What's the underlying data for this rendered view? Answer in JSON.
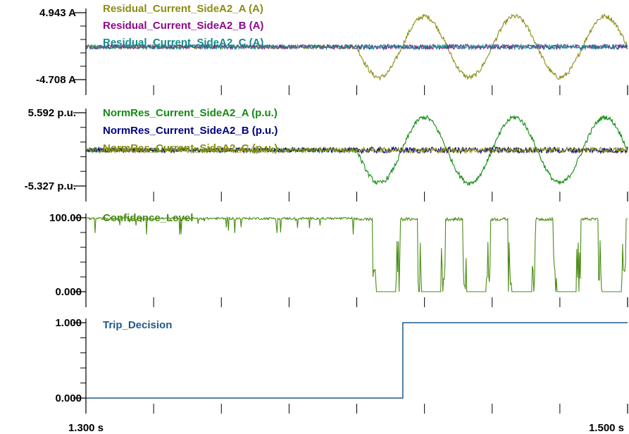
{
  "chart_data": [
    {
      "type": "line",
      "ytick_labels": [
        "4.943 A",
        "-4.708 A"
      ],
      "ylim": [
        -4.708,
        4.943
      ],
      "x": [
        1.3,
        1.5
      ],
      "series": [
        {
          "name": "Residual_Current_SideA2_A (A)",
          "color": "#8c8c14",
          "description_values": {
            "pre_fault_amplitude": 0.3,
            "fault_start": 1.4,
            "fault_amplitude": 4.4,
            "frequency_hz": 30
          }
        },
        {
          "name": "Residual_Current_SideA2_B (A)",
          "color": "#8b0a8b",
          "description_values": {
            "pre_fault_amplitude": 0.3,
            "fault_amplitude": 0.35
          }
        },
        {
          "name": "Residual_Current_SideA2_C (A)",
          "color": "#148c8c",
          "description_values": {
            "pre_fault_amplitude": 0.3,
            "fault_amplitude": 0.35
          }
        }
      ]
    },
    {
      "type": "line",
      "ytick_labels": [
        "5.592 p.u.",
        "-5.327 p.u."
      ],
      "ylim": [
        -5.327,
        5.592
      ],
      "x": [
        1.3,
        1.5
      ],
      "series": [
        {
          "name": "NormRes_Current_SideA2_A (p.u.)",
          "color": "#148c14",
          "description_values": {
            "pre_fault_amplitude": 0.35,
            "fault_start": 1.4,
            "fault_amplitude": 4.9,
            "frequency_hz": 30
          }
        },
        {
          "name": "NormRes_Current_SideA2_B (p.u.)",
          "color": "#000080",
          "description_values": {
            "pre_fault_amplitude": 0.35,
            "fault_amplitude": 0.45
          }
        },
        {
          "name": "NormRes_Current_SideA2_C (p.u.)",
          "color": "#8c8c14",
          "description_values": {
            "pre_fault_amplitude": 0.35,
            "fault_amplitude": 0.4
          }
        }
      ]
    },
    {
      "type": "line",
      "ytick_labels": [
        "100.00",
        "0.000"
      ],
      "ylim": [
        0,
        100
      ],
      "x": [
        1.3,
        1.5
      ],
      "series": [
        {
          "name": "Confidence_Level",
          "color": "#4b8c14",
          "description_values": {
            "pre_fault_level": 99,
            "fault_start": 1.4,
            "dip_frequency_hz": 60
          }
        }
      ]
    },
    {
      "type": "line",
      "ytick_labels": [
        "1.000",
        "0.000"
      ],
      "ylim": [
        0,
        1
      ],
      "x": [
        1.3,
        1.5
      ],
      "series": [
        {
          "name": "Trip_Decision",
          "color": "#1e5a8c",
          "steps": [
            [
              1.3,
              0
            ],
            [
              1.417,
              0
            ],
            [
              1.417,
              1
            ],
            [
              1.5,
              1
            ]
          ]
        }
      ]
    }
  ],
  "xaxis": {
    "start_label": "1.300 s",
    "end_label": "1.500 s",
    "xlim": [
      1.3,
      1.5
    ]
  }
}
